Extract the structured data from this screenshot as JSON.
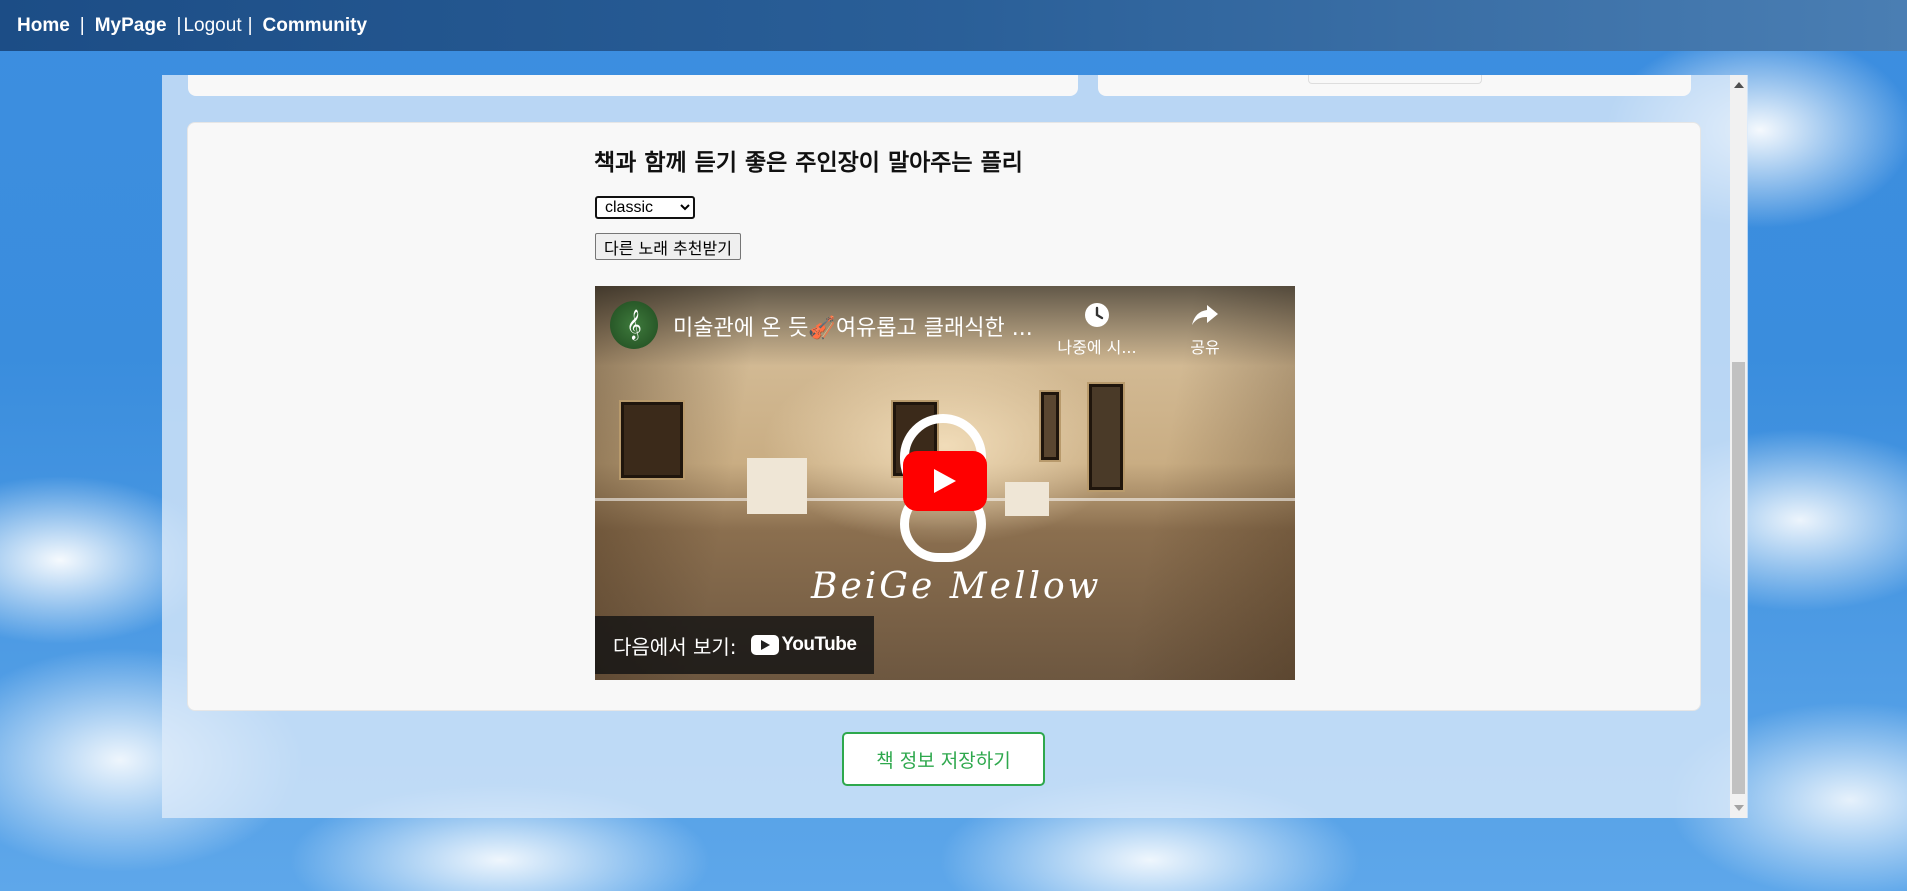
{
  "nav": {
    "home": "Home",
    "sep1": "|",
    "mypage": "MyPage",
    "sep2": "|",
    "logout": "Logout",
    "sep3": "|",
    "community": "Community"
  },
  "playlist": {
    "title": "책과 함께 듣기 좋은 주인장이 말아주는 플리",
    "genre_selected": "classic",
    "genre_options": [
      "classic"
    ],
    "recommend_label": "다른 노래 추천받기"
  },
  "video": {
    "title": "미술관에 온 듯🎻여유롭고 클래식한 ...",
    "watch_later": "나중에 시...",
    "share": "공유",
    "brand": "BeiGe Mellow",
    "watch_on": "다음에서 보기:",
    "platform": "YouTube",
    "icons": [
      "channel-avatar",
      "clock-icon",
      "share-icon",
      "play-icon",
      "youtube-logo"
    ]
  },
  "actions": {
    "save_label": "책 정보 저장하기"
  },
  "colors": {
    "nav_bg": "#1c4d86",
    "save_accent": "#2ea84d",
    "play_red": "#ff0000"
  }
}
